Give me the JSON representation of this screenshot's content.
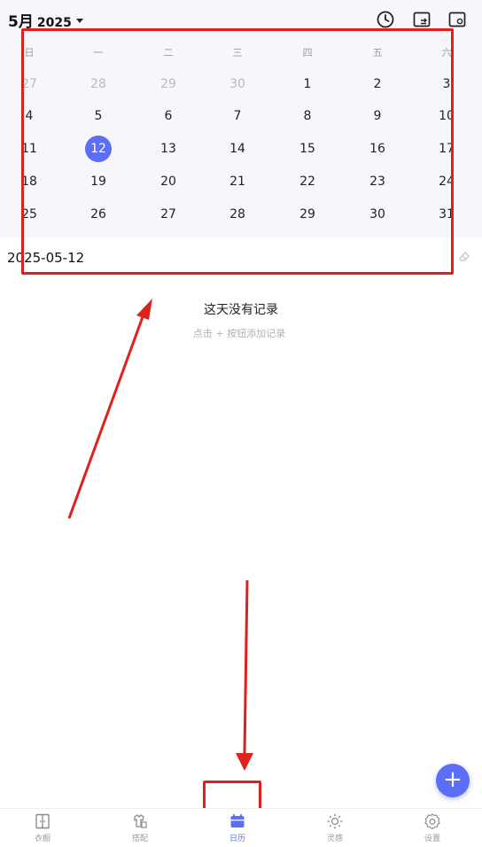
{
  "header": {
    "month": "5月",
    "year": "2025",
    "icons": [
      "clock-icon",
      "switch-view-icon",
      "screen-settings-icon"
    ]
  },
  "calendar": {
    "weekdays": [
      "日",
      "一",
      "二",
      "三",
      "四",
      "五",
      "六"
    ],
    "weeks": [
      [
        "27",
        "28",
        "29",
        "30",
        "1",
        "2",
        "3"
      ],
      [
        "4",
        "5",
        "6",
        "7",
        "8",
        "9",
        "10"
      ],
      [
        "11",
        "12",
        "13",
        "14",
        "15",
        "16",
        "17"
      ],
      [
        "18",
        "19",
        "20",
        "21",
        "22",
        "23",
        "24"
      ],
      [
        "25",
        "26",
        "27",
        "28",
        "29",
        "30",
        "31"
      ]
    ],
    "selected": "12"
  },
  "date_label": "2025-05-12",
  "empty_state": {
    "title": "这天没有记录",
    "subtitle": "点击 + 按钮添加记录"
  },
  "fab": {
    "label": "+"
  },
  "bottom_nav": {
    "items": [
      {
        "label": "衣橱",
        "icon": "wardrobe-icon"
      },
      {
        "label": "搭配",
        "icon": "outfit-icon"
      },
      {
        "label": "日历",
        "icon": "calendar-icon"
      },
      {
        "label": "灵感",
        "icon": "inspiration-icon"
      },
      {
        "label": "设置",
        "icon": "settings-icon"
      }
    ],
    "active_label": "日历"
  },
  "colors": {
    "accent": "#5b6ef5",
    "annotation": "#e0201b",
    "calendar_bg": "#f7f7fb"
  }
}
